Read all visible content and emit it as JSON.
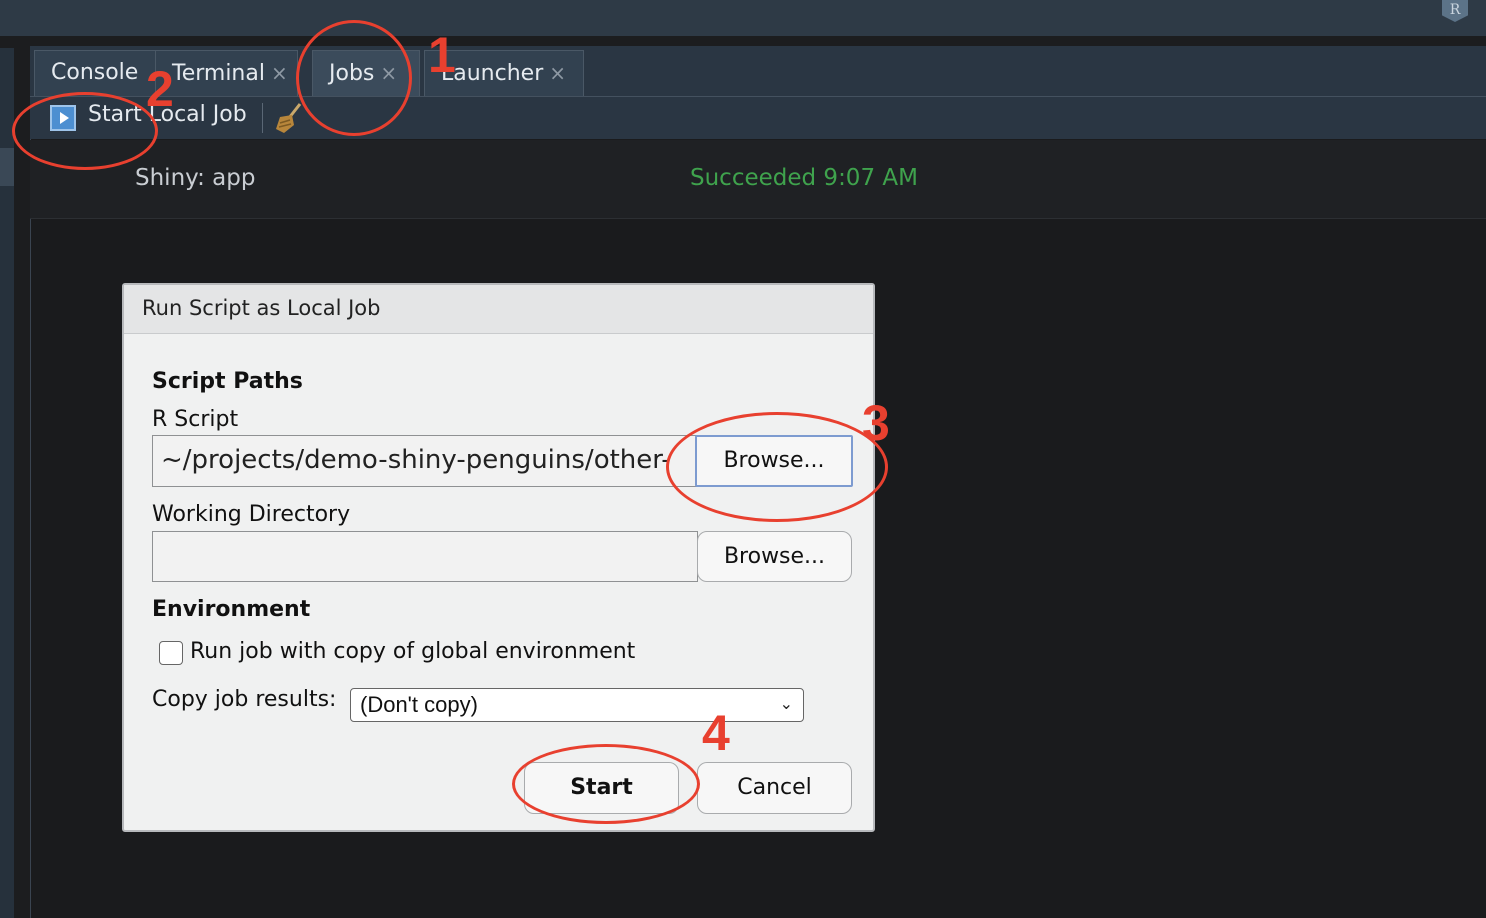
{
  "colors": {
    "accent_red": "#e8402f",
    "status_success": "#3fa34d",
    "dialog_bg": "#f0f1f1",
    "pane_bg": "#1a1b1d"
  },
  "top_bar": {
    "logo_letter": "R",
    "logo_icon": "rstudio-logo-icon"
  },
  "tabs": [
    {
      "label": "Console",
      "closable": false
    },
    {
      "label": "Terminal",
      "closable": true
    },
    {
      "label": "Jobs",
      "closable": true,
      "active": true
    },
    {
      "label": "Launcher",
      "closable": true
    }
  ],
  "tab_close_glyph": "×",
  "toolbar": {
    "start_local_job_label": "Start Local Job",
    "play_icon": "play-icon",
    "clear_icon": "broom-icon"
  },
  "job": {
    "name": "Shiny: app",
    "status": "Succeeded 9:07 AM"
  },
  "dialog": {
    "title": "Run Script as Local Job",
    "script_paths_heading": "Script Paths",
    "r_script_label": "R Script",
    "r_script_value": "~/projects/demo-shiny-penguins/other-",
    "browse_label": "Browse...",
    "working_directory_label": "Working Directory",
    "working_directory_value": "",
    "environment_heading": "Environment",
    "copy_env_checkbox_label": "Run job with copy of global environment",
    "copy_env_checked": false,
    "copy_results_label": "Copy job results:",
    "copy_results_value": "(Don't copy)",
    "start_label": "Start",
    "cancel_label": "Cancel"
  },
  "annotations": [
    "1",
    "2",
    "3",
    "4"
  ]
}
